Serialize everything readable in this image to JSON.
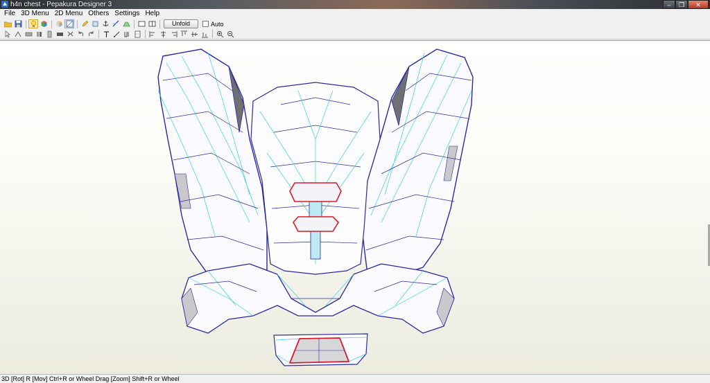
{
  "window": {
    "title": "h4n chest - Pepakura Designer 3",
    "app_icon": "pepakura-logo-icon"
  },
  "menu": {
    "items": [
      "File",
      "3D Menu",
      "2D Menu",
      "Others",
      "Settings",
      "Help"
    ]
  },
  "toolbar": {
    "row1_icons": [
      "open-folder-icon",
      "save-icon",
      "bulb-icon",
      "cube-icon",
      "texture-icon",
      "view-mode-icon",
      "pencil-icon",
      "rotate-part-icon",
      "anchor-icon",
      "edge-icon",
      "flap-icon",
      "window-single-icon",
      "window-split-icon"
    ],
    "unfold_label": "Unfold",
    "auto_label": "Auto",
    "auto_checked": false,
    "row2_icons": [
      "select-icon",
      "join-edge-icon",
      "edit-flap-icon",
      "move-icon",
      "rotate-icon",
      "scale-icon",
      "flip-icon",
      "undo-part-icon",
      "redo-part-icon",
      "add-text-icon",
      "line-icon",
      "bend-icon",
      "fold-icon",
      "align-left-icon",
      "align-center-icon",
      "align-right-icon",
      "align-top-icon",
      "align-middle-icon",
      "align-bottom-icon",
      "zoom-in-icon",
      "zoom-out-icon"
    ]
  },
  "status": {
    "text": "3D [Rot] R [Mov] Ctrl+R or Wheel Drag [Zoom] Shift+R or Wheel"
  },
  "colors": {
    "mesh_edge": "#2a2a9c",
    "mesh_fold": "#34d0e0",
    "selected_edge": "#d81a2a",
    "face": "#ffffff",
    "shade": "#c9c9cc"
  }
}
